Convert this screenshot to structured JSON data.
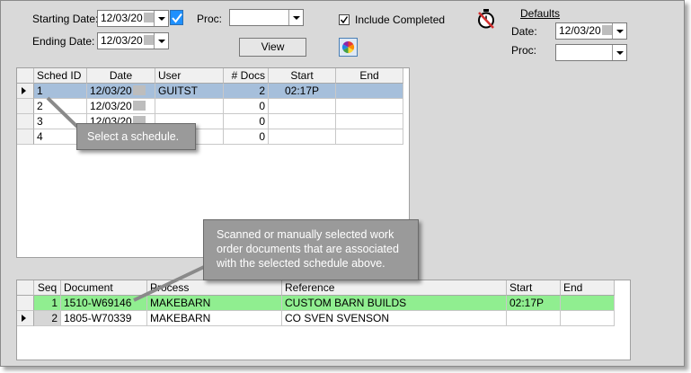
{
  "filters": {
    "starting_date_label": "Starting Date:",
    "starting_date_value": "12/03/20",
    "ending_date_label": "Ending Date:",
    "ending_date_value": "12/03/20",
    "proc_label": "Proc:",
    "proc_value": "",
    "include_completed_label": "Include Completed",
    "include_completed_checked": true,
    "view_button": "View"
  },
  "defaults": {
    "title": "Defaults",
    "date_label": "Date:",
    "date_value": "12/03/20",
    "proc_label": "Proc:",
    "proc_value": ""
  },
  "schedules": {
    "columns": [
      "Sched ID",
      "Date",
      "User",
      "# Docs",
      "Start",
      "End"
    ],
    "rows": [
      {
        "id": "1",
        "date": "12/03/20",
        "user": "GUITST",
        "docs": "2",
        "start": "02:17P",
        "end": ""
      },
      {
        "id": "2",
        "date": "12/03/20",
        "user": "",
        "docs": "0",
        "start": "",
        "end": ""
      },
      {
        "id": "3",
        "date": "12/03/20",
        "user": "",
        "docs": "0",
        "start": "",
        "end": ""
      },
      {
        "id": "4",
        "date": "",
        "user": "",
        "docs": "0",
        "start": "",
        "end": ""
      }
    ],
    "selected_row": 0
  },
  "documents": {
    "columns": [
      "Seq",
      "Document",
      "Process",
      "Reference",
      "Start",
      "End"
    ],
    "rows": [
      {
        "seq": "1",
        "document": "1510-W69146",
        "process": "MAKEBARN",
        "reference": "CUSTOM BARN BUILDS",
        "start": "02:17P",
        "end": ""
      },
      {
        "seq": "2",
        "document": "1805-W70339",
        "process": "MAKEBARN",
        "reference": "CO SVEN SVENSON",
        "start": "",
        "end": ""
      }
    ]
  },
  "callouts": {
    "select_schedule": "Select a schedule.",
    "documents_note": "Scanned or manually selected work order documents that are associated with the selected schedule above."
  },
  "colors": {
    "selected_row": "#a6bfdb",
    "highlight_row": "#90ee90",
    "check_accent": "#1e90ff"
  },
  "icons": {
    "stopwatch": "stopwatch-off-icon",
    "color_wheel": "color-wheel-icon"
  }
}
